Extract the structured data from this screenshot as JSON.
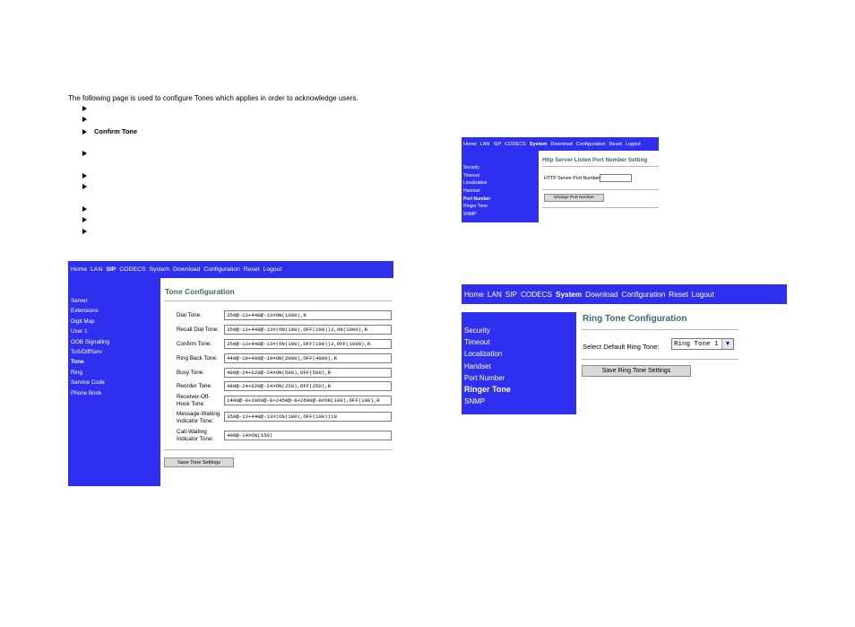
{
  "intro": {
    "text": "The following page is used to configure Tones which applies in order to acknowledge users.",
    "bullets": [
      "",
      "",
      "Confirm Tone",
      "",
      "",
      "",
      "",
      "",
      ""
    ]
  },
  "tone_panel": {
    "nav": [
      "Home",
      "LAN",
      "SIP",
      "CODECS",
      "System",
      "Download",
      "Configuration",
      "Reset",
      "Logout"
    ],
    "nav_active": "SIP",
    "side": [
      "Server",
      "Extensions",
      "Digit Map",
      "User 1",
      "OOB Signalling",
      "ToS/DiffServ",
      "Tone",
      "Ring",
      "Service Code",
      "Phone Book"
    ],
    "side_active": "Tone",
    "title": "Tone Configuration",
    "rows": [
      {
        "label": "Dial Tone:",
        "value": "350@-13+440@-13#ON(1000),R"
      },
      {
        "label": "Recall Dial Tone:",
        "value": "350@-13+440@-13#(ON(100),OFF(100))3,ON(1000),R"
      },
      {
        "label": "Confirm Tone:",
        "value": "350@-13+440@-13#(ON(100),OFF(100))3,OFF(1000),R"
      },
      {
        "label": "Ring Back Tone:",
        "value": "440@-19+480@-19#ON(2000),OFF(4000),R"
      },
      {
        "label": "Busy Tone:",
        "value": "480@-24+620@-24#ON(500),OFF(500),R"
      },
      {
        "label": "Reorder Tone:",
        "value": "480@-24+620@-24#ON(250),OFF(250),R"
      },
      {
        "label": "Receiver-Off-Hook Tone:",
        "value": "1400@-8+2060@-8+2450@-8+2600@-8#ON(100),OFF(100),R"
      },
      {
        "label": "Message-Waiting Indicator Tone:",
        "value": "350@-13+440@-13#(ON(100),OFF(100))10"
      },
      {
        "label": "Call-Waiting Indicator Tone:",
        "value": "400@-14#ON(150)"
      }
    ],
    "save_button": "Save Tone Settings"
  },
  "port_panel": {
    "nav": [
      "Home",
      "LAN",
      "SIP",
      "CODECS",
      "System",
      "Download",
      "Configuration",
      "Reset",
      "Logout"
    ],
    "nav_active": "System",
    "side": [
      "Security",
      "Timeout",
      "Localization",
      "Handset",
      "Port Number",
      "Ringer Tone",
      "SNMP"
    ],
    "side_active": "Port Number",
    "title": "Http Server Listen Port Number Setting",
    "field_label": "HTTP Server Port Number:",
    "field_value": "",
    "button": "Change Port Number"
  },
  "ring_panel": {
    "nav": [
      "Home",
      "LAN",
      "SIP",
      "CODECS",
      "System",
      "Download",
      "Configuration",
      "Reset",
      "Logout"
    ],
    "nav_active": "System",
    "side": [
      "Security",
      "Timeout",
      "Localization",
      "Handset",
      "Port Number",
      "Ringer Tone",
      "SNMP"
    ],
    "side_active": "Ringer Tone",
    "title": "Ring Tone Configuration",
    "select_label": "Select Default Ring Tone:",
    "select_value": "Ring Tone 1",
    "button": "Save Ring Tone Settings"
  },
  "colors": {
    "nav_bg": "#2f2ff0",
    "title": "#3a6a6a"
  }
}
